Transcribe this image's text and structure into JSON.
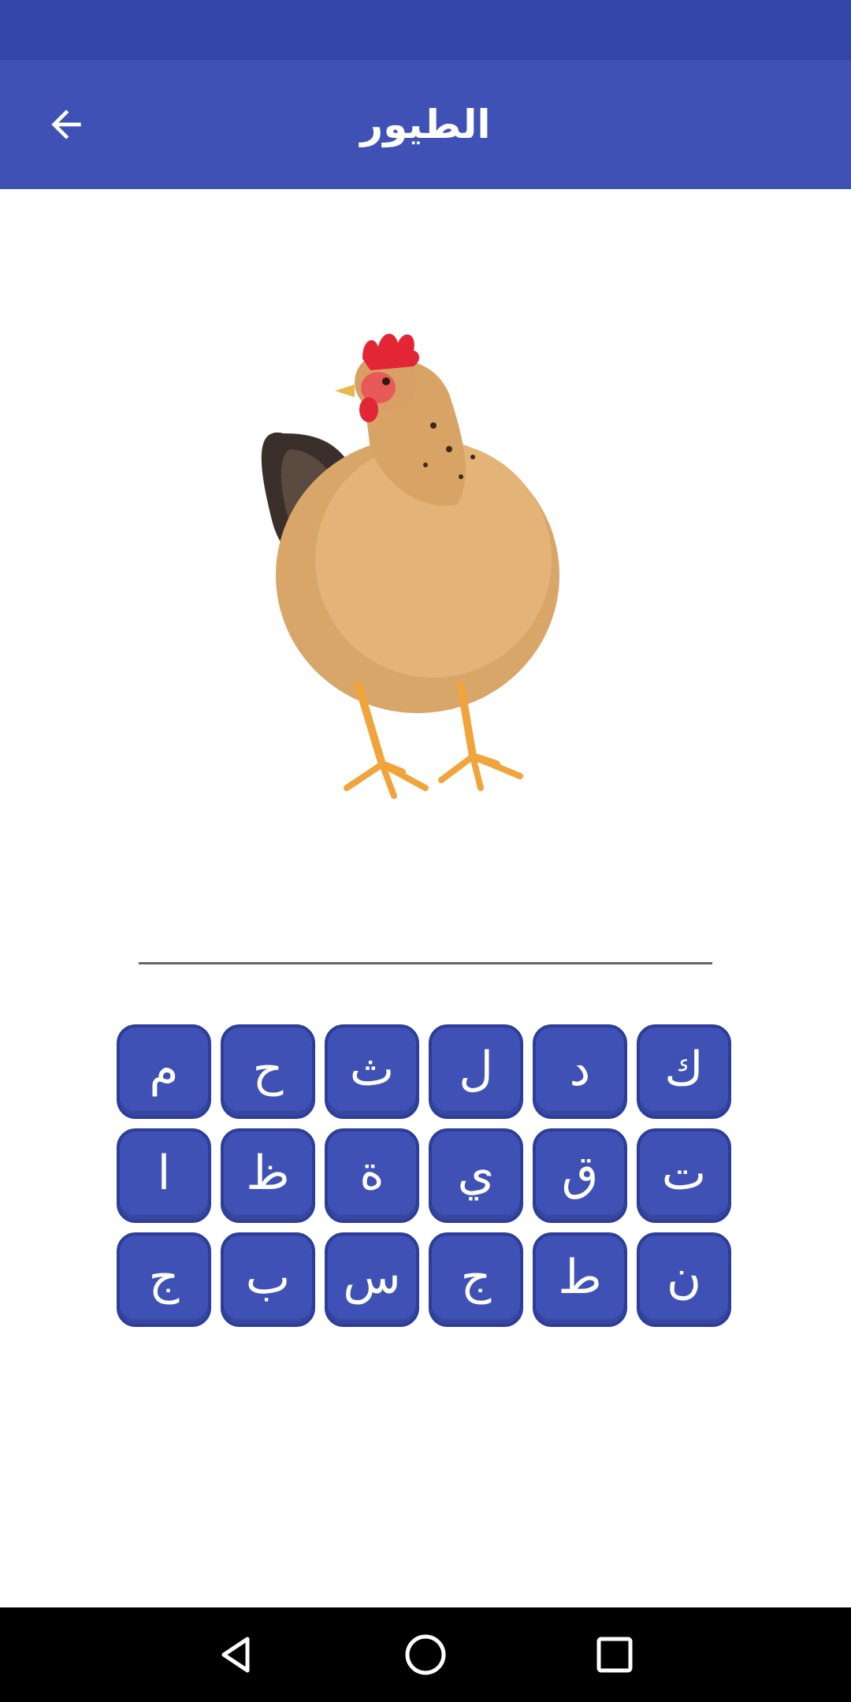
{
  "app_bar": {
    "title": "الطيور",
    "back_icon": "arrow-back-icon"
  },
  "quiz": {
    "image": "chicken",
    "answer": ""
  },
  "keyboard": {
    "rows": [
      [
        "م",
        "ح",
        "ث",
        "ل",
        "د",
        "ك"
      ],
      [
        "ا",
        "ظ",
        "ة",
        "ي",
        "ق",
        "ت"
      ],
      [
        "ج",
        "ب",
        "س",
        "ج",
        "ط",
        "ن"
      ]
    ]
  },
  "nav": {
    "back_icon": "triangle-back-icon",
    "home_icon": "circle-home-icon",
    "recents_icon": "square-recents-icon"
  },
  "colors": {
    "status_bar": "#3347a8",
    "app_bar": "#3f51b5",
    "key_fill": "#3f51b5",
    "key_border": "#2d3d99"
  }
}
